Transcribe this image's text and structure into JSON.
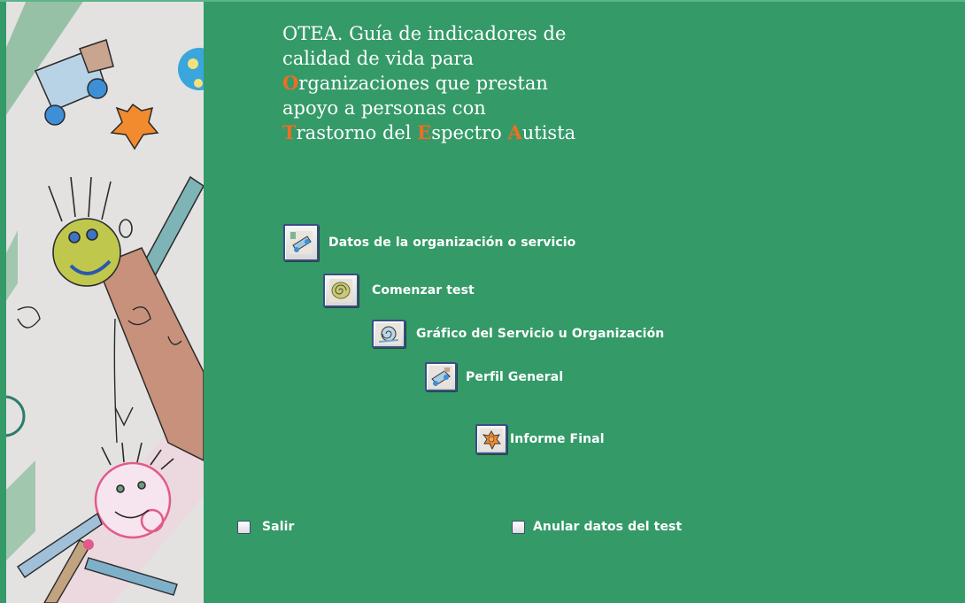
{
  "title": {
    "line1": "OTEA. Guía de indicadores de",
    "line2": "calidad de vida para",
    "line3_initial": "O",
    "line3_rest": "rganizaciones que prestan",
    "line4": "apoyo a personas con",
    "line5_initial_t": "T",
    "line5_rest_t": "rastorno del ",
    "line5_initial_e": "E",
    "line5_rest_e": "spectro ",
    "line5_initial_a": "A",
    "line5_rest_a": "utista"
  },
  "menu": {
    "datos_label": "Datos de la organización o servicio",
    "comenzar_label": "Comenzar test",
    "grafico_label": "Gráfico del Servicio u Organización",
    "perfil_label": "Perfil General",
    "informe_label": "Informe Final"
  },
  "options": {
    "salir_label": "Salir",
    "anular_label": "Anular datos del test"
  },
  "colors": {
    "background": "#349a68",
    "accent": "#f06d22",
    "text": "#ffffff"
  }
}
